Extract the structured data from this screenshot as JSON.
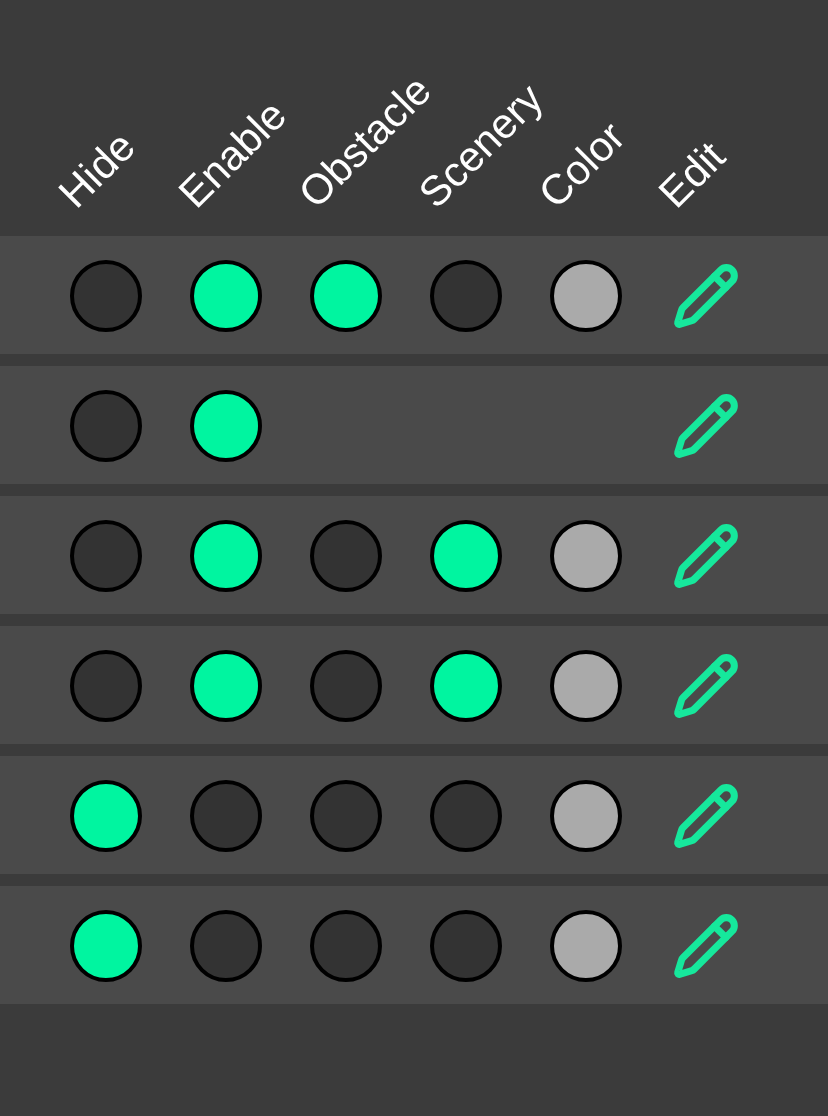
{
  "columns": [
    "Hide",
    "Enable",
    "Obstacle",
    "Scenery",
    "Color",
    "Edit"
  ],
  "rows": [
    {
      "kind": "full",
      "hide": false,
      "enable": true,
      "obstacle": true,
      "scenery": false,
      "color": "#aaaaaa"
    },
    {
      "kind": "basic",
      "hide": false,
      "enable": true
    },
    {
      "kind": "full",
      "hide": false,
      "enable": true,
      "obstacle": false,
      "scenery": true,
      "color": "#aaaaaa"
    },
    {
      "kind": "full",
      "hide": false,
      "enable": true,
      "obstacle": false,
      "scenery": true,
      "color": "#aaaaaa"
    },
    {
      "kind": "full",
      "hide": true,
      "enable": false,
      "obstacle": false,
      "scenery": false,
      "color": "#aaaaaa"
    },
    {
      "kind": "full",
      "hide": true,
      "enable": false,
      "obstacle": false,
      "scenery": false,
      "color": "#aaaaaa"
    }
  ]
}
